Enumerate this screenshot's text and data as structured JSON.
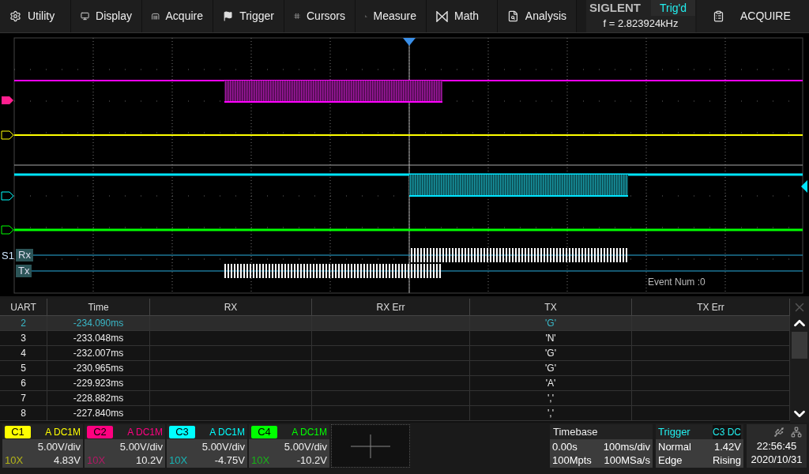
{
  "menu": [
    {
      "label": "Utility"
    },
    {
      "label": "Display"
    },
    {
      "label": "Acquire"
    },
    {
      "label": "Trigger"
    },
    {
      "label": "Cursors"
    },
    {
      "label": "Measure"
    },
    {
      "label": "Math"
    },
    {
      "label": "Analysis"
    }
  ],
  "brand": {
    "logo": "SIGLENT",
    "status": "Trig'd",
    "frequency": "f = 2.823924kHz"
  },
  "mode_button": "ACQUIRE",
  "waveform": {
    "bus_label": "S1",
    "lanes": [
      "Rx",
      "Tx"
    ],
    "event_count": "Event Num :0"
  },
  "table": {
    "columns": [
      "UART",
      "Time",
      "RX",
      "RX Err",
      "TX",
      "TX Err"
    ],
    "rows": [
      {
        "uart": "2",
        "time": "-234.090ms",
        "tx": "'G'",
        "selected": true
      },
      {
        "uart": "3",
        "time": "-233.048ms",
        "tx": "'N'",
        "selected": false
      },
      {
        "uart": "4",
        "time": "-232.007ms",
        "tx": "'G'",
        "selected": false
      },
      {
        "uart": "5",
        "time": "-230.965ms",
        "tx": "'G'",
        "selected": false
      },
      {
        "uart": "6",
        "time": "-229.923ms",
        "tx": "'A'",
        "selected": false
      },
      {
        "uart": "7",
        "time": "-228.882ms",
        "tx": "','",
        "selected": false
      },
      {
        "uart": "8",
        "time": "-227.840ms",
        "tx": "','",
        "selected": false
      }
    ]
  },
  "channels": [
    {
      "name": "C1",
      "color": "#ffff00",
      "coupling": "A DC1M",
      "scale": "5.00V/div",
      "probe": "10X",
      "offset": "4.83V"
    },
    {
      "name": "C2",
      "color": "#ff0080",
      "coupling": "A DC1M",
      "scale": "5.00V/div",
      "probe": "10X",
      "offset": "10.2V"
    },
    {
      "name": "C3",
      "color": "#00ffff",
      "coupling": "A DC1M",
      "scale": "5.00V/div",
      "probe": "10X",
      "offset": "-4.75V"
    },
    {
      "name": "C4",
      "color": "#00ff00",
      "coupling": "A DC1M",
      "scale": "5.00V/div",
      "probe": "10X",
      "offset": "-10.2V"
    }
  ],
  "timebase": {
    "title": "Timebase",
    "delay": "0.00s",
    "scale": "100ms/div",
    "memory": "100Mpts",
    "sample_rate": "100MSa/s"
  },
  "trigger": {
    "title": "Trigger",
    "source": "C3 DC",
    "mode": "Normal",
    "level": "1.42V",
    "type": "Edge",
    "slope": "Rising"
  },
  "clock": {
    "time": "22:56:45",
    "date": "2020/10/31"
  }
}
